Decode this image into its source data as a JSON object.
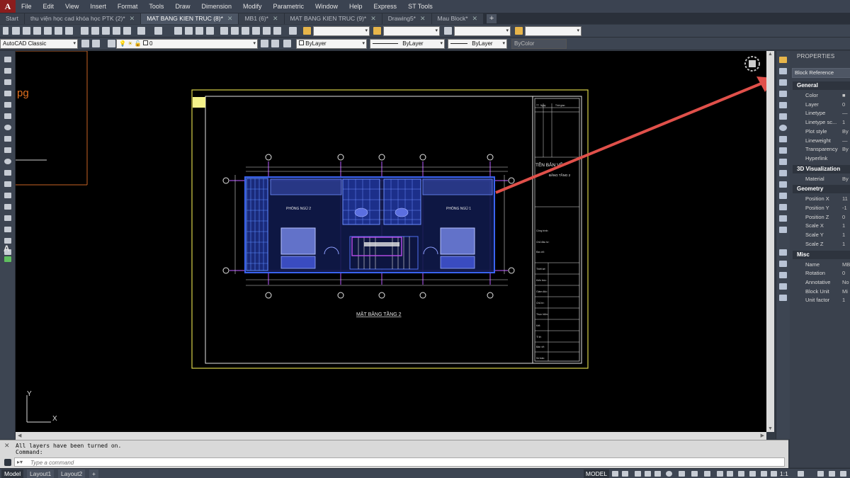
{
  "app": {
    "logo": "A"
  },
  "menu": [
    "File",
    "Edit",
    "View",
    "Insert",
    "Format",
    "Tools",
    "Draw",
    "Dimension",
    "Modify",
    "Parametric",
    "Window",
    "Help",
    "Express",
    "ST Tools"
  ],
  "tabs": [
    {
      "label": "Start",
      "active": false,
      "closable": false
    },
    {
      "label": "thu viện học cad khóa học PTK (2)*",
      "active": false,
      "closable": true
    },
    {
      "label": "MAT BANG KIEN TRUC (8)*",
      "active": true,
      "closable": true
    },
    {
      "label": "MB1 (6)*",
      "active": false,
      "closable": true
    },
    {
      "label": "MAT BANG KIEN TRUC (9)*",
      "active": false,
      "closable": true
    },
    {
      "label": "Drawing5*",
      "active": false,
      "closable": true
    },
    {
      "label": "Mau Block*",
      "active": false,
      "closable": true
    }
  ],
  "new_tab": "+",
  "toolbar2": {
    "workspace": "AutoCAD Classic",
    "layer": "0",
    "color": "ByLayer",
    "linetype": "ByLayer",
    "lineweight": "ByLayer",
    "plotstyle": "ByColor"
  },
  "canvas": {
    "left_fragment_text": "pg",
    "ucs_x": "X",
    "ucs_y": "Y"
  },
  "drawing": {
    "room_left": "PHÒNG NGỦ 2",
    "room_right": "PHÒNG NGỦ 1",
    "plan_title": "MẶT BẰNG TẦNG 2",
    "titleblock_heading": "TÊN BẢN VẼ",
    "titleblock_sub": "BẰNG TẦNG 2",
    "tb_col1": "TT",
    "tb_col2": "Ngày",
    "tb_col3": "Thời gian",
    "tb_labels": [
      "Công trình:",
      "Chủ đầu tư:",
      "Địa chỉ:",
      "Thiết kế:",
      "Kiến trúc:",
      "Giám đốc:",
      "Chủ trì:",
      "Thực hiện:",
      "Kết:",
      "Tỉ lệ:",
      "Bản vẽ:",
      "Số bản:",
      "Tờ số:"
    ]
  },
  "properties": {
    "title": "PROPERTIES",
    "selection": "Block Reference",
    "sections": [
      {
        "name": "General",
        "rows": [
          {
            "name": "Color",
            "value": "■"
          },
          {
            "name": "Layer",
            "value": "0"
          },
          {
            "name": "Linetype",
            "value": "—"
          },
          {
            "name": "Linetype sc...",
            "value": "1"
          },
          {
            "name": "Plot style",
            "value": "By"
          },
          {
            "name": "Lineweight",
            "value": "—"
          },
          {
            "name": "Transparency",
            "value": "By"
          },
          {
            "name": "Hyperlink",
            "value": ""
          }
        ]
      },
      {
        "name": "3D Visualization",
        "rows": [
          {
            "name": "Material",
            "value": "By"
          }
        ]
      },
      {
        "name": "Geometry",
        "rows": [
          {
            "name": "Position X",
            "value": "11"
          },
          {
            "name": "Position Y",
            "value": "-1"
          },
          {
            "name": "Position Z",
            "value": "0"
          },
          {
            "name": "Scale X",
            "value": "1"
          },
          {
            "name": "Scale Y",
            "value": "1"
          },
          {
            "name": "Scale Z",
            "value": "1"
          }
        ]
      },
      {
        "name": "Misc",
        "rows": [
          {
            "name": "Name",
            "value": "MB"
          },
          {
            "name": "Rotation",
            "value": "0"
          },
          {
            "name": "Annotative",
            "value": "No"
          },
          {
            "name": "Block Unit",
            "value": "Mi"
          },
          {
            "name": "Unit factor",
            "value": "1"
          }
        ]
      }
    ]
  },
  "command": {
    "history": [
      "All layers have been turned on.",
      "Command:"
    ],
    "placeholder": "Type a command"
  },
  "status": {
    "layout_tabs": [
      "Model",
      "Layout1",
      "Layout2"
    ],
    "add_layout": "+",
    "mode": "MODEL",
    "scale": "1:1"
  },
  "colors": {
    "accent_arrow": "#e0504a",
    "plan_blue": "#3a63f0",
    "sheet_border": "#d9d24a",
    "grid_purple": "#9b4dd8"
  }
}
